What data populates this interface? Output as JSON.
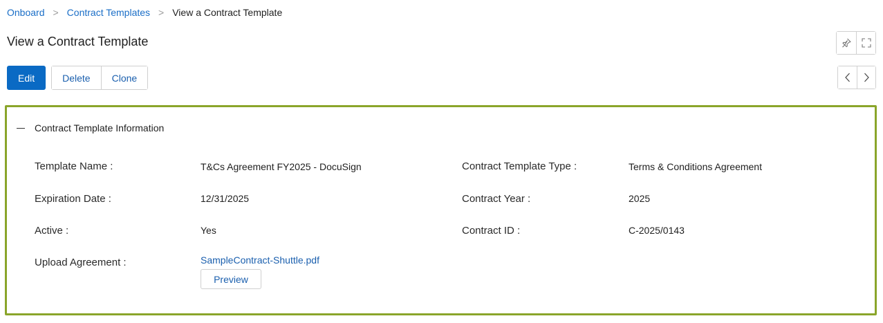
{
  "breadcrumb": {
    "items": [
      "Onboard",
      "Contract Templates"
    ],
    "current": "View a Contract Template",
    "separator": ">"
  },
  "page": {
    "title": "View a Contract Template"
  },
  "toolbar": {
    "edit_label": "Edit",
    "delete_label": "Delete",
    "clone_label": "Clone"
  },
  "icons": {
    "pin": "pin-icon",
    "fullscreen": "fullscreen-icon",
    "prev": "chevron-left-icon",
    "next": "chevron-right-icon"
  },
  "colors": {
    "primary": "#0a6ac4",
    "link": "#1a5fae",
    "panel_border": "#8aa52a"
  },
  "section": {
    "title": "Contract Template Information",
    "fields": {
      "template_name": {
        "label": "Template Name :",
        "value": "T&Cs Agreement FY2025 - DocuSign"
      },
      "expiration_date": {
        "label": "Expiration Date :",
        "value": "12/31/2025"
      },
      "active": {
        "label": "Active :",
        "value": "Yes"
      },
      "upload_agreement": {
        "label": "Upload Agreement :",
        "value": "SampleContract-Shuttle.pdf",
        "preview_label": "Preview"
      },
      "contract_template_type": {
        "label": "Contract Template Type :",
        "value": "Terms & Conditions Agreement"
      },
      "contract_year": {
        "label": "Contract Year :",
        "value": "2025"
      },
      "contract_id": {
        "label": "Contract ID :",
        "value": "C-2025/0143"
      }
    }
  }
}
